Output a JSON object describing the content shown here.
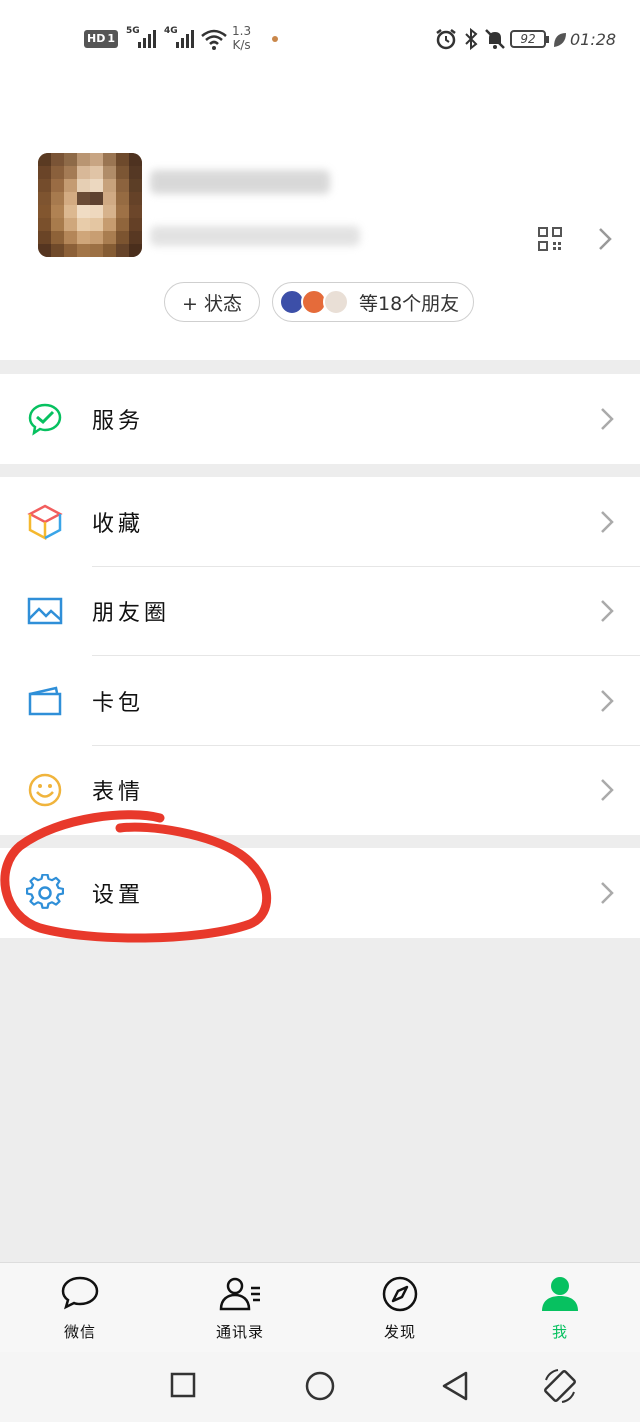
{
  "status_bar": {
    "hd": "HD",
    "sim": "1",
    "net1": "5G",
    "net2": "4G",
    "speed_value": "1.3",
    "speed_unit": "K/s",
    "battery": "92",
    "time": "01:28"
  },
  "profile": {
    "status_button": "+ 状态",
    "friends_label": "等18个朋友"
  },
  "menu": {
    "service": "服务",
    "favorites": "收藏",
    "moments": "朋友圈",
    "cards": "卡包",
    "stickers": "表情",
    "settings": "设置"
  },
  "tabs": [
    {
      "label": "微信",
      "icon": "chat-bubble-icon"
    },
    {
      "label": "通讯录",
      "icon": "contacts-icon"
    },
    {
      "label": "发现",
      "icon": "compass-icon"
    },
    {
      "label": "我",
      "icon": "person-icon"
    }
  ],
  "colors": {
    "accent_green": "#07c160",
    "annotation_red": "#e8392b",
    "background": "#ededed"
  }
}
